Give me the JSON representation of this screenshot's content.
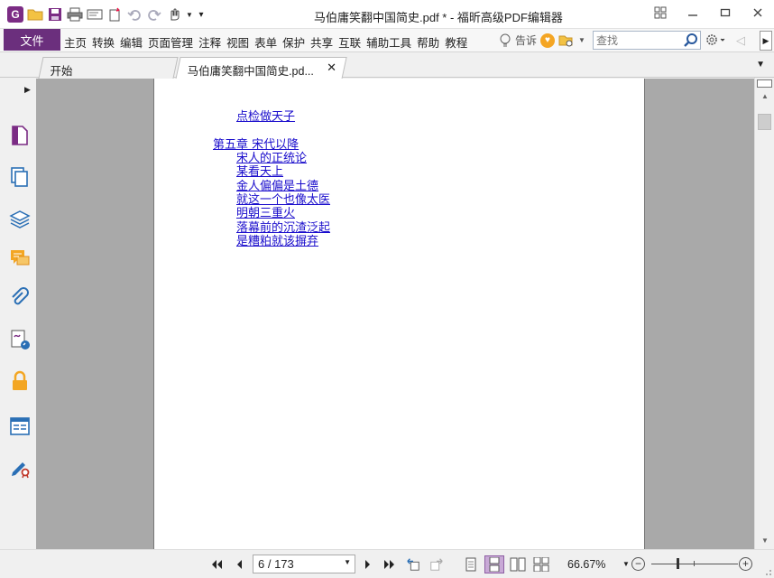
{
  "window": {
    "title": "马伯庸笑翻中国简史.pdf * - 福昕高级PDF编辑器",
    "controls": [
      "restore-layout",
      "minimize",
      "maximize",
      "close"
    ]
  },
  "quick_access": [
    "app-logo",
    "open-folder",
    "save",
    "print",
    "email",
    "new",
    "undo",
    "redo",
    "hand-tool"
  ],
  "menubar": {
    "file_label": "文件",
    "items": [
      "主页",
      "转换",
      "编辑",
      "页面管理",
      "注释",
      "视图",
      "表单",
      "保护",
      "共享",
      "互联",
      "辅助工具",
      "帮助",
      "教程"
    ],
    "tellme_label": "告诉",
    "search_placeholder": "查找"
  },
  "tabs": [
    {
      "label": "开始",
      "active": false
    },
    {
      "label": "马伯庸笑翻中国简史.pd...",
      "active": true
    }
  ],
  "sidebar": {
    "items": [
      "pages-icon",
      "layers-copy-icon",
      "layers-icon",
      "comments-icon",
      "attachments-icon",
      "signatures-icon",
      "security-icon",
      "form-fields-icon",
      "certify-icon"
    ]
  },
  "document": {
    "toc": [
      {
        "text": "点检做天子",
        "level": 2
      },
      {
        "text": "第五章 宋代以降",
        "level": 1
      },
      {
        "text": "宋人的正统论",
        "level": 2
      },
      {
        "text": "某看天上",
        "level": 2
      },
      {
        "text": "金人偏偏是土德",
        "level": 2
      },
      {
        "text": "就这一个也像太医",
        "level": 2
      },
      {
        "text": "明朝三重火",
        "level": 2
      },
      {
        "text": "落幕前的沉渣泛起",
        "level": 2
      },
      {
        "text": "是糟粕就该摒弃",
        "level": 2
      }
    ],
    "link_color": "#1a0dcc"
  },
  "statusbar": {
    "page_display": "6 / 173",
    "current_page": 6,
    "total_pages": 173,
    "zoom": "66.67%",
    "zoom_value": 66.67
  },
  "colors": {
    "accent": "#6b2f7d",
    "doc_background": "#a9a9a9",
    "active_view": "#c8a9d6"
  }
}
